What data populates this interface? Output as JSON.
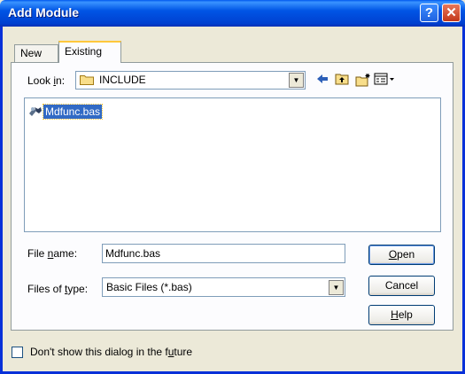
{
  "window": {
    "title": "Add Module",
    "help_glyph": "?",
    "close_glyph": "✕"
  },
  "tabs": [
    {
      "label": "New"
    },
    {
      "label": "Existing"
    }
  ],
  "look_in": {
    "label_prefix": "Look ",
    "label_accel": "i",
    "label_suffix": "n:",
    "value": "INCLUDE"
  },
  "toolbar": {
    "back_icon": "arrow-left-icon",
    "up_icon": "folder-up-icon",
    "newfolder_icon": "new-folder-icon",
    "views_icon": "views-menu-icon"
  },
  "files": [
    {
      "name": "Mdfunc.bas",
      "icon": "basic-module-icon",
      "selected": true
    }
  ],
  "file_name": {
    "label_prefix": "File ",
    "label_accel": "n",
    "label_suffix": "ame:",
    "value": "Mdfunc.bas"
  },
  "file_type": {
    "label_prefix": "Files of ",
    "label_accel": "t",
    "label_suffix": "ype:",
    "value": "Basic Files (*.bas)"
  },
  "buttons": {
    "open_accel": "O",
    "open_rest": "pen",
    "cancel": "Cancel",
    "help_accel": "H",
    "help_rest": "elp"
  },
  "dont_show": {
    "label_prefix": "Don't show this dialog in the f",
    "label_accel": "u",
    "label_suffix": "ture",
    "checked": false
  },
  "colors": {
    "titlebar": "#0055E5",
    "face": "#ECE9D8",
    "selection": "#316AC5"
  }
}
